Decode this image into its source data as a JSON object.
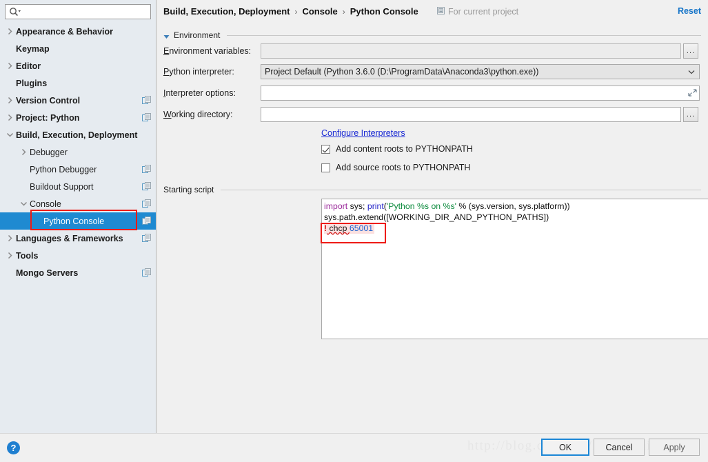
{
  "search": {
    "value": "",
    "placeholder": "",
    "icon": "search-icon"
  },
  "sidebar": {
    "items": [
      {
        "label": "Appearance & Behavior",
        "arrow": "right",
        "indent": 0,
        "bold": true,
        "badge": false,
        "selected": false
      },
      {
        "label": "Keymap",
        "arrow": "none",
        "indent": 0,
        "bold": true,
        "badge": false,
        "selected": false
      },
      {
        "label": "Editor",
        "arrow": "right",
        "indent": 0,
        "bold": true,
        "badge": false,
        "selected": false
      },
      {
        "label": "Plugins",
        "arrow": "none",
        "indent": 0,
        "bold": true,
        "badge": false,
        "selected": false
      },
      {
        "label": "Version Control",
        "arrow": "right",
        "indent": 0,
        "bold": true,
        "badge": true,
        "selected": false
      },
      {
        "label": "Project: Python",
        "arrow": "right",
        "indent": 0,
        "bold": true,
        "badge": true,
        "selected": false
      },
      {
        "label": "Build, Execution, Deployment",
        "arrow": "down",
        "indent": 0,
        "bold": true,
        "badge": false,
        "selected": false
      },
      {
        "label": "Debugger",
        "arrow": "right",
        "indent": 1,
        "bold": false,
        "badge": false,
        "selected": false
      },
      {
        "label": "Python Debugger",
        "arrow": "none",
        "indent": 1,
        "bold": false,
        "badge": true,
        "selected": false
      },
      {
        "label": "Buildout Support",
        "arrow": "none",
        "indent": 1,
        "bold": false,
        "badge": true,
        "selected": false
      },
      {
        "label": "Console",
        "arrow": "down",
        "indent": 1,
        "bold": false,
        "badge": true,
        "selected": false
      },
      {
        "label": "Python Console",
        "arrow": "none",
        "indent": 2,
        "bold": false,
        "badge": true,
        "selected": true
      },
      {
        "label": "Languages & Frameworks",
        "arrow": "right",
        "indent": 0,
        "bold": true,
        "badge": true,
        "selected": false
      },
      {
        "label": "Tools",
        "arrow": "right",
        "indent": 0,
        "bold": true,
        "badge": false,
        "selected": false
      },
      {
        "label": "Mongo Servers",
        "arrow": "none",
        "indent": 0,
        "bold": true,
        "badge": true,
        "selected": false
      }
    ]
  },
  "header": {
    "breadcrumb": [
      "Build, Execution, Deployment",
      "Console",
      "Python Console"
    ],
    "separator": "›",
    "for_current_project": "For current project",
    "for_current_project_icon": "module-scope-icon",
    "reset_label": "Reset"
  },
  "environment": {
    "section_title": "Environment",
    "env_vars": {
      "label": "Environment variables:",
      "mnemonic": "E",
      "value": "",
      "browse_label": "..."
    },
    "interpreter": {
      "label": "Python interpreter:",
      "mnemonic": "P",
      "value": "Project Default (Python 3.6.0 (D:\\ProgramData\\Anaconda3\\python.exe))"
    },
    "interpreter_options": {
      "label": "Interpreter options:",
      "mnemonic": "I",
      "value": ""
    },
    "working_directory": {
      "label": "Working directory:",
      "mnemonic": "W",
      "value": "",
      "browse_label": "..."
    },
    "configure_link": "Configure Interpreters",
    "checkboxes": [
      {
        "label": "Add content roots to PYTHONPATH",
        "checked": true
      },
      {
        "label": "Add source roots to PYTHONPATH",
        "checked": false
      }
    ]
  },
  "starting_script": {
    "section_title": "Starting script",
    "lines": [
      [
        {
          "t": "import",
          "c": "kw"
        },
        {
          "t": " sys; ",
          "c": "plain"
        },
        {
          "t": "print",
          "c": "fn"
        },
        {
          "t": "(",
          "c": "plain"
        },
        {
          "t": "'Python %s on %s'",
          "c": "str"
        },
        {
          "t": " % (sys.version, sys.platform))",
          "c": "plain"
        }
      ],
      [
        {
          "t": "sys.path.extend([WORKING_DIR_AND_PYTHON_PATHS])",
          "c": "plain"
        }
      ],
      [
        {
          "t": "!",
          "c": "bang"
        },
        {
          "t": " chcp ",
          "c": "squig"
        },
        {
          "t": "65001",
          "c": "num"
        }
      ]
    ],
    "error_line_index": 2
  },
  "annotations": {
    "tree_highlight_color": "#ee1b16",
    "code_highlight_color": "#ee1b16"
  },
  "footer": {
    "help_label": "?",
    "watermark": "http://blog.csdn.net/haiyanshihu",
    "ok_label": "OK",
    "cancel_label": "Cancel",
    "apply_label": "Apply"
  }
}
